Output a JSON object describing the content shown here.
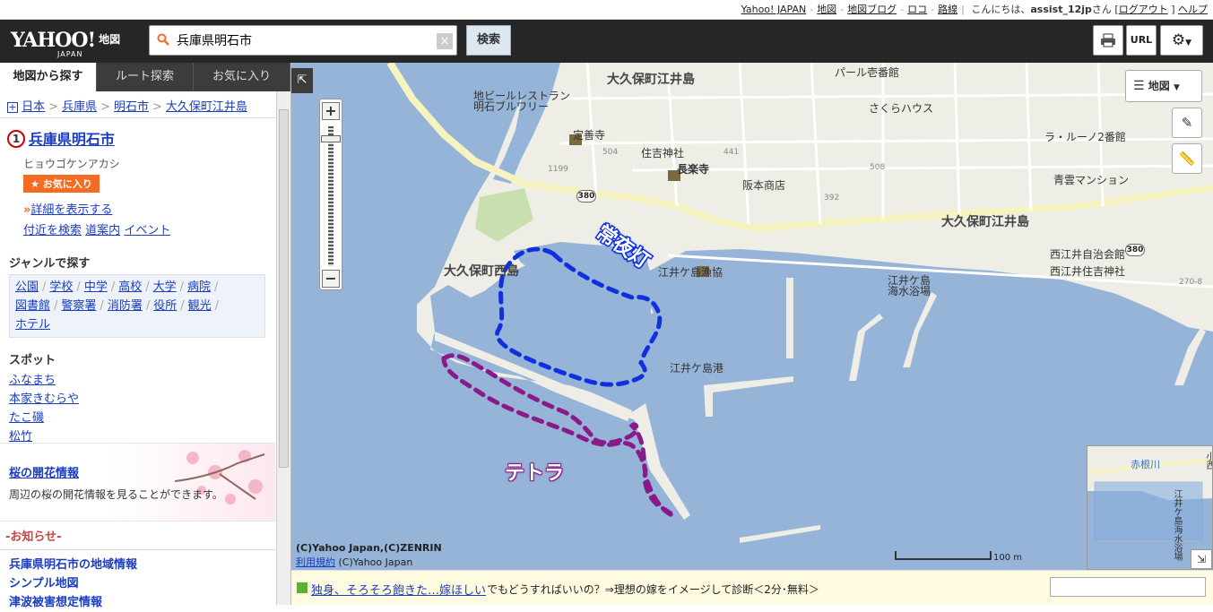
{
  "util": {
    "links": [
      "Yahoo! JAPAN",
      "地図",
      "地図ブログ",
      "ロコ",
      "路線"
    ],
    "greeting_pre": "こんにちは、",
    "user": "assist_12jp",
    "greeting_post": "さん [",
    "logout": "ログアウト",
    "help": "ヘルプ"
  },
  "header": {
    "logo": "YAHOO!",
    "logo_sub": "JAPAN",
    "logo_service": "地図",
    "search_value": "兵庫県明石市",
    "search_button": "検索",
    "url_button": "URL"
  },
  "sidebar": {
    "tabs": [
      "地図から探す",
      "ルート探索",
      "お気に入り"
    ],
    "breadcrumb": [
      "日本",
      "兵庫県",
      "明石市",
      "大久保町江井島"
    ],
    "place": {
      "number": "1",
      "name": "兵庫県明石市",
      "kana": "ヒョウゴケンアカシ",
      "fav": "お気に入り",
      "detail": "詳細を表示する",
      "nearby": "付近を検索",
      "guide": "道案内",
      "event": "イベント"
    },
    "genre_title": "ジャンルで探す",
    "genres": [
      "公園",
      "学校",
      "中学",
      "高校",
      "大学",
      "病院",
      "図書館",
      "警察署",
      "消防署",
      "役所",
      "観光",
      "ホテル"
    ],
    "spot_title": "スポット",
    "spots": [
      "ふなまち",
      "本家きむらや",
      "たこ磯",
      "松竹"
    ],
    "sakura_title": "桜の開花情報",
    "sakura_desc": "周辺の桜の開花情報を見ることができます。",
    "notice_title": "-お知らせ-",
    "notices": [
      "兵庫県明石市の地域情報",
      "シンプル地図",
      "津波被害想定情報"
    ]
  },
  "map": {
    "labels": {
      "town1": "大久保町江井島",
      "town2": "大久保町江井島",
      "town3": "大久保町西島",
      "pearl": "パール壱番館",
      "beer": "地ビールレストラン",
      "brewery": "明石ブルワリー",
      "sakura": "さくらハウス",
      "jozenji": "定善寺",
      "sumiyoshi": "住吉神社",
      "chorakuji": "長楽寺",
      "sakamoto": "阪本商店",
      "larune": "ラ・ルーノ2番館",
      "seibou": "青雲マンション",
      "jichikai": "西江井自治会館",
      "nishisumiyoshi": "西江井住吉神社",
      "gyokyo": "江井ケ島漁協",
      "beach1": "江井ケ島",
      "beach2": "海水浴場",
      "port": "江井ケ島港",
      "route": "380",
      "nums": [
        "1199",
        "504",
        "441",
        "392",
        "508",
        "270-8"
      ]
    },
    "annotation_blue": "常夜灯",
    "annotation_purple": "テトラ",
    "layer_button": "地図",
    "copyright1": "(C)Yahoo Japan,(C)ZENRIN",
    "terms": "利用規約",
    "copyright2": "(C)Yahoo Japan",
    "scale": "100 m",
    "mini": {
      "river": "赤根川",
      "beach": "江井ケ島海水浴場",
      "edge": "小西"
    },
    "colors": {
      "sea": "#95b4d8",
      "land": "#eeeee6",
      "blue_annot": "#1030e0",
      "purple_annot": "#8a1a8a"
    }
  },
  "ad": {
    "title": "独身、そろそろ飽きた…嫁ほしい",
    "text": "でもどうすればいいの？⇒理想の嫁をイメージして診断＜2分･無料＞"
  }
}
